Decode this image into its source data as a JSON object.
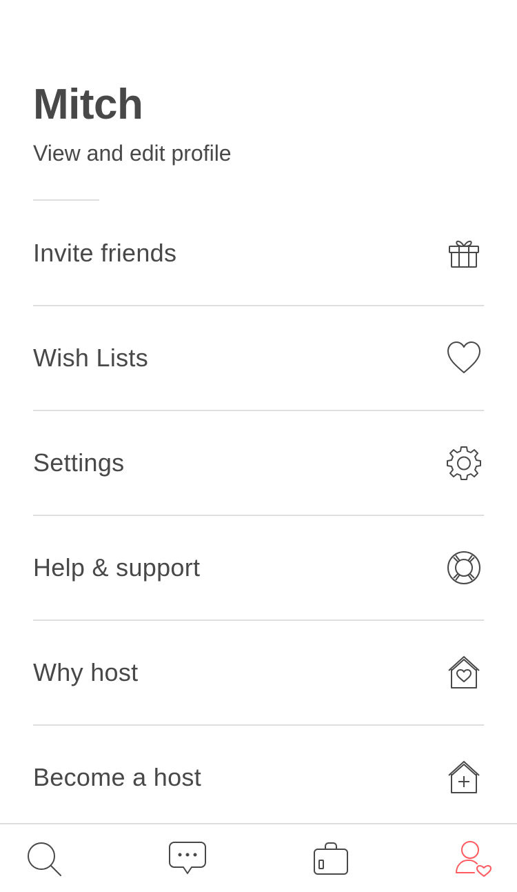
{
  "profile": {
    "name": "Mitch",
    "link_label": "View and edit profile"
  },
  "menu": {
    "items": [
      {
        "label": "Invite friends",
        "icon": "gift-icon"
      },
      {
        "label": "Wish Lists",
        "icon": "heart-icon"
      },
      {
        "label": "Settings",
        "icon": "gear-icon"
      },
      {
        "label": "Help & support",
        "icon": "lifebuoy-icon"
      },
      {
        "label": "Why host",
        "icon": "house-heart-icon"
      },
      {
        "label": "Become a host",
        "icon": "house-plus-icon"
      }
    ]
  },
  "tab_bar": {
    "tabs": [
      {
        "icon": "search-icon",
        "active": false
      },
      {
        "icon": "chat-bubble-icon",
        "active": false
      },
      {
        "icon": "luggage-icon",
        "active": false
      },
      {
        "icon": "profile-heart-icon",
        "active": true
      }
    ]
  },
  "colors": {
    "text": "#484848",
    "divider": "#dedede",
    "accent": "#ff5a5f",
    "icon": "#484848"
  }
}
